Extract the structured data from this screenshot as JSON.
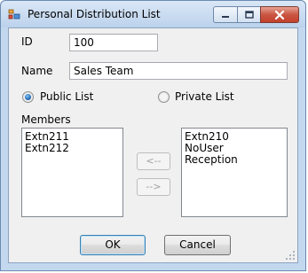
{
  "window": {
    "title": "Personal Distribution List",
    "icons": {
      "app": "distribution-list-icon",
      "minimize": "minimize-icon",
      "maximize": "maximize-icon",
      "close": "close-icon"
    }
  },
  "form": {
    "id_label": "ID",
    "id_value": "100",
    "name_label": "Name",
    "name_value": "Sales Team",
    "public_label": "Public List",
    "private_label": "Private List",
    "list_type_selected": "Public List",
    "members_label": "Members",
    "members": [
      "Extn211",
      "Extn212"
    ],
    "available": [
      "Extn210",
      "NoUser",
      "Reception"
    ],
    "move_left_label": "<--",
    "move_right_label": "-->"
  },
  "buttons": {
    "ok": "OK",
    "cancel": "Cancel"
  },
  "colors": {
    "title_bar": "#c3d7ee",
    "close_button": "#c4402c",
    "dialog_face": "#f0f0f0",
    "radio_selected": "#1a5aa8"
  }
}
